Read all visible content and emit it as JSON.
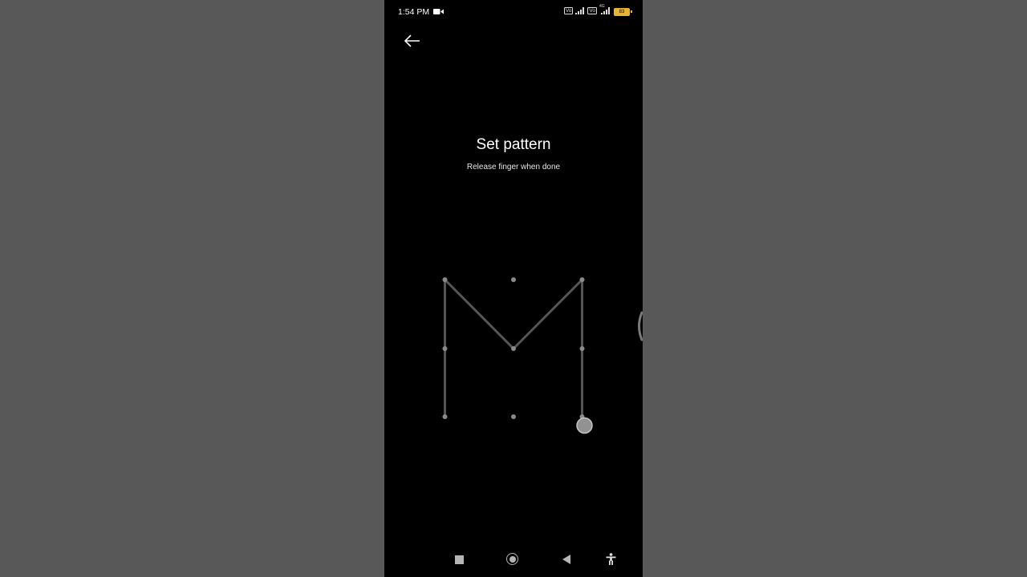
{
  "status_bar": {
    "time": "1:54 PM",
    "icons": [
      "screen-record-icon",
      "volte-icon",
      "signal-icon",
      "volte-icon",
      "4g-signal-icon",
      "battery-icon"
    ],
    "volte_label": "Vo",
    "network_label": "4G",
    "battery_level": "83"
  },
  "header": {
    "back_icon": "arrow-left-icon"
  },
  "main": {
    "title": "Set pattern",
    "subtitle": "Release finger when done"
  },
  "pattern": {
    "grid": "3x3",
    "selected_sequence": [
      7,
      4,
      1,
      5,
      3,
      6,
      9
    ],
    "active_dot": 9,
    "line_color": "#555555",
    "dot_color": "#8a8a8a"
  },
  "nav_bar": {
    "icons": [
      "recents-icon",
      "home-icon",
      "back-icon",
      "accessibility-icon"
    ]
  },
  "colors": {
    "background": "#000000",
    "letterbox": "#595959",
    "text": "#ffffff",
    "battery": "#e6b43a"
  }
}
